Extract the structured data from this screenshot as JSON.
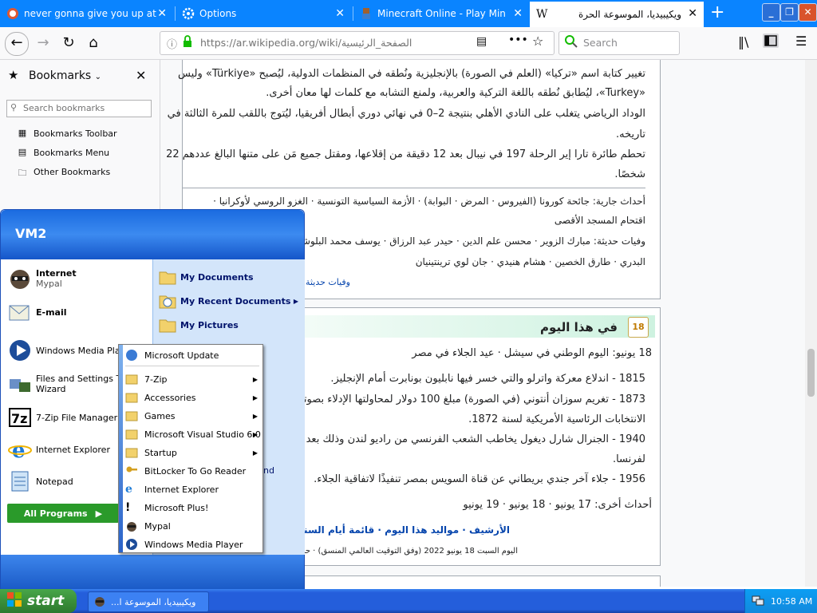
{
  "browser": {
    "tabs": [
      {
        "label": "never gonna give you up at Duck"
      },
      {
        "label": "Options"
      },
      {
        "label": "Minecraft Online - Play Minecraft"
      },
      {
        "label": "ويكيبيديا، الموسوعة الحرة"
      }
    ],
    "new_tab": "+",
    "url_prefix": "https://ar.wikipedia.org/wiki/",
    "url_path": "الصفحة_الرئيسية",
    "search_placeholder": "Search",
    "window_buttons": {
      "minimize": "_",
      "maximize": "❐",
      "close": "✕"
    }
  },
  "sidebar": {
    "title": "Bookmarks",
    "search_placeholder": "Search bookmarks",
    "items": [
      {
        "label": "Bookmarks Toolbar"
      },
      {
        "label": "Bookmarks Menu"
      },
      {
        "label": "Other Bookmarks"
      }
    ]
  },
  "wiki": {
    "news": [
      {
        "text": "تغيير كتابة اسم «تركيا» (العلم في الصورة) بالإنجليزية ونُطقه في المنظمات الدولية، ليُصبح «Türkiye» وليس"
      },
      {
        "text": "«Turkey»، ليُطابق نُطقه باللغة التركية والعربية، ولمنع التشابه مع كلمات لها معان أخرى."
      },
      {
        "text": "الوداد الرياضي يتغلب على النادي الأهلي بنتيجة 2–0 في نهائي دوري أبطال أفريقيا، ليُتوج باللقب للمرة الثالثة في"
      },
      {
        "text": "تاريخه."
      },
      {
        "text": "تحطم طائرة تارا إير الرحلة 197 في نيبال بعد 12 دقيقة من إقلاعها، ومقتل جميع مَن على متنها البالغ عددهم 22"
      },
      {
        "text": "شخصًا."
      }
    ],
    "current_events": "أحداث جارية: جائحة كورونا (الفيروس · المرض · البوابة) · الأزمة السياسية التونسية · الغزو الروسي لأوكرانيا ·",
    "current_events_2": "اقتحام المسجد الأقصى",
    "recent_deaths": "وفيات حديثة: مبارك الزوير · محسن علم الدين · حيدر عبد الرزاق · يوسف محمد البلوشي ·",
    "recent_deaths_2": "البدري · طارق الخصين · هشام هنيدي · جان لوي ترينتينيان",
    "recent_deaths_link": "وفيات حديثة",
    "otd_title": "في هذا اليوم",
    "otd_date_line": "18 يونيو: اليوم الوطني في سيشل · عيد الجلاء في مصر",
    "otd_items": [
      {
        "text": "1815 - اندلاع معركة واترلو والتي خسر فيها نابليون بونابرت أمام الإنجليز."
      },
      {
        "text": "1873 - تغريم سوزان أنتوني (في الصورة) مبلغ 100 دولار لمحاولتها الإدلاء بصوتها"
      },
      {
        "text": "الانتخابات الرئاسية الأمريكية لسنة 1872."
      },
      {
        "text": "1940 - الجنرال شارل ديغول يخاطب الشعب الفرنسي من راديو لندن وذلك بعد الاحتلال"
      },
      {
        "text": "لفرنسا."
      },
      {
        "text": "1956 - جلاء آخر جندي بريطاني عن قناة السويس بمصر تنفيذًا لاتفاقية الجلاء."
      }
    ],
    "other_days": "أحداث أخرى: 17 يونيو · 18 يونيو · 19 يونيو",
    "archive_links": "الأرشيف · مواليد هذا اليوم · قائمة أيام السنة",
    "footer_line": "اليوم السبت 18 يونيو 2022 (وفق التوقيت العالمي المنسق) · حدِّث الصفحة",
    "otd_icon_number": "18"
  },
  "startmenu": {
    "username": "VM2",
    "left_items": [
      {
        "label": "Internet",
        "sub": "Mypal"
      },
      {
        "label": "E-mail",
        "sub": ""
      },
      {
        "label": "Windows Media Player",
        "sub": ""
      },
      {
        "label": "Files and Settings Transfer",
        "sub": "Wizard"
      },
      {
        "label": "7-Zip File Manager",
        "sub": ""
      },
      {
        "label": "Internet Explorer",
        "sub": ""
      },
      {
        "label": "Notepad",
        "sub": ""
      }
    ],
    "all_programs": "All Programs",
    "right_items": [
      {
        "label": "My Documents"
      },
      {
        "label": "My Recent Documents"
      },
      {
        "label": "My Pictures"
      }
    ],
    "right_partial": "nd",
    "programs": [
      {
        "label": "Microsoft Update",
        "arrow": false
      },
      {
        "label": "7-Zip",
        "arrow": true
      },
      {
        "label": "Accessories",
        "arrow": true
      },
      {
        "label": "Games",
        "arrow": true
      },
      {
        "label": "Microsoft Visual Studio 6.0",
        "arrow": true
      },
      {
        "label": "Startup",
        "arrow": true
      },
      {
        "label": "BitLocker To Go Reader",
        "arrow": false
      },
      {
        "label": "Internet Explorer",
        "arrow": false
      },
      {
        "label": "Microsoft Plus!",
        "arrow": false
      },
      {
        "label": "Mypal",
        "arrow": false
      },
      {
        "label": "Windows Media Player",
        "arrow": false
      }
    ]
  },
  "taskbar": {
    "start": "start",
    "task_label": "ويكيبيديا، الموسوعة ا...",
    "clock": "10:58 AM"
  },
  "colors": {
    "accent": "#0a84ff",
    "xp_blue": "#245edb",
    "link": "#0645ad"
  }
}
